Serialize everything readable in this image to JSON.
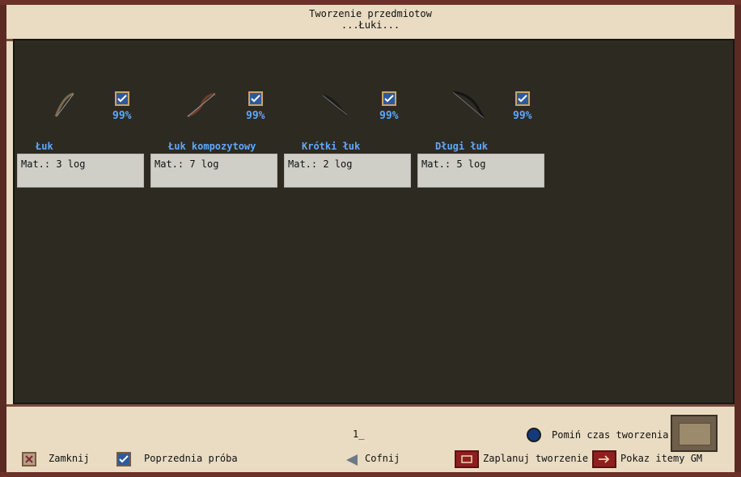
{
  "window": {
    "title": "Tworzenie przedmiotow",
    "subtitle": "...Łuki..."
  },
  "items": [
    {
      "name": "Łuk",
      "material": "Mat.: 3 log",
      "chance": "99%",
      "icon": "bow-icon"
    },
    {
      "name": "Łuk kompozytowy",
      "material": "Mat.: 7 log",
      "chance": "99%",
      "icon": "composite-bow-icon"
    },
    {
      "name": "Krótki łuk",
      "material": "Mat.: 2 log",
      "chance": "99%",
      "icon": "short-bow-icon"
    },
    {
      "name": "Długi łuk",
      "material": "Mat.: 5 log",
      "chance": "99%",
      "icon": "long-bow-icon"
    }
  ],
  "footer": {
    "page_number": "1_",
    "skip_time_label": "Pomiń czas tworzenia",
    "close_label": "Zamknij",
    "previous_attempt_label": "Poprzednia próba",
    "back_label": "Cofnij",
    "schedule_label": "Zaplanuj tworzenie",
    "show_gm_items_label": "Pokaz itemy GM"
  },
  "colors": {
    "accent_blue": "#5ea8ff",
    "panel_dark": "#2d2a22",
    "parchment": "#e9dcc2"
  }
}
